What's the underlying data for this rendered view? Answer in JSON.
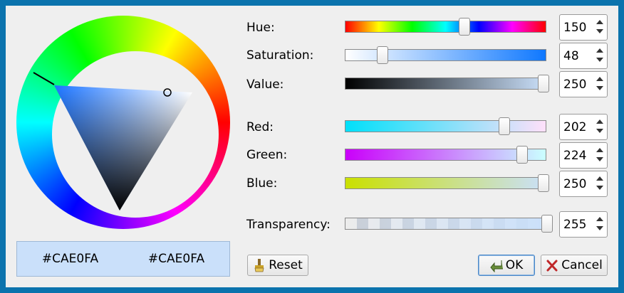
{
  "color_hex": "#CAE0FA",
  "swatches": {
    "current": "#CAE0FA",
    "previous": "#CAE0FA"
  },
  "labels": {
    "hue": "Hue:",
    "saturation": "Saturation:",
    "value": "Value:",
    "red": "Red:",
    "green": "Green:",
    "blue": "Blue:",
    "transparency": "Transparency:"
  },
  "values": {
    "hue": "150",
    "saturation": "48",
    "value": "250",
    "red": "202",
    "green": "224",
    "blue": "250",
    "transparency": "255"
  },
  "buttons": {
    "reset": "Reset",
    "ok": "OK",
    "cancel": "Cancel"
  },
  "icons": {
    "reset": "brush-icon",
    "ok": "check-arrow-icon",
    "cancel": "x-icon"
  }
}
